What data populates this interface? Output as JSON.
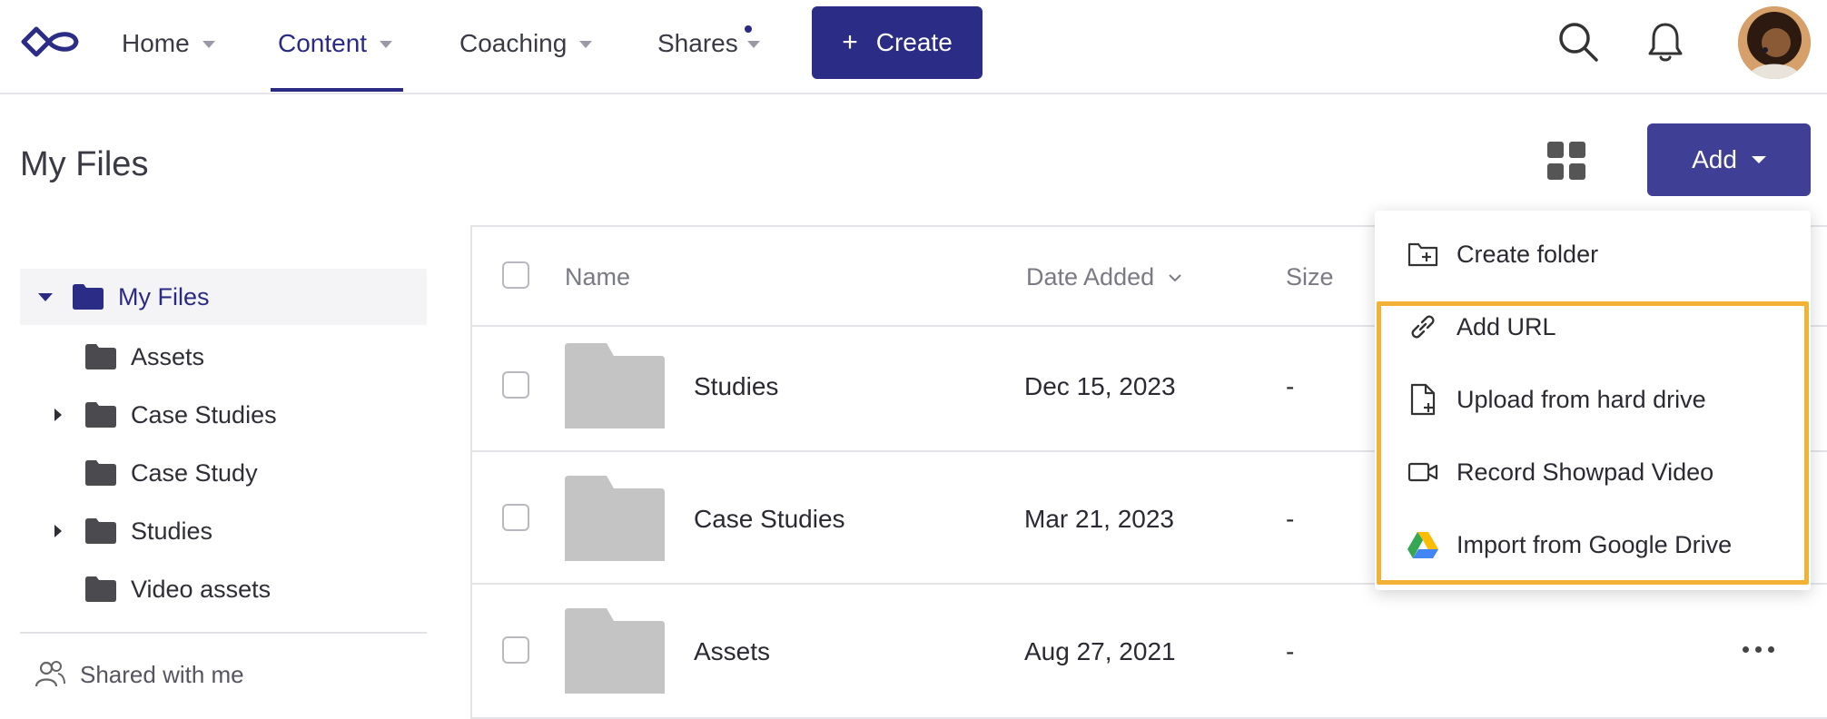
{
  "nav": {
    "items": [
      {
        "label": "Home",
        "active": false
      },
      {
        "label": "Content",
        "active": true
      },
      {
        "label": "Coaching",
        "active": false
      },
      {
        "label": "Shares",
        "active": false
      }
    ],
    "create_label": "Create",
    "icons": [
      "search-icon",
      "bell-icon"
    ]
  },
  "page": {
    "title": "My Files",
    "add_label": "Add"
  },
  "sidebar": {
    "root": "My Files",
    "children": [
      {
        "label": "Assets",
        "expandable": false
      },
      {
        "label": "Case Studies",
        "expandable": true
      },
      {
        "label": "Case Study",
        "expandable": false
      },
      {
        "label": "Studies",
        "expandable": true
      },
      {
        "label": "Video assets",
        "expandable": false
      }
    ],
    "shared_label": "Shared with me"
  },
  "table": {
    "headers": {
      "name": "Name",
      "date": "Date Added",
      "size": "Size"
    },
    "rows": [
      {
        "name": "Studies",
        "date": "Dec 15, 2023",
        "size": "-"
      },
      {
        "name": "Case Studies",
        "date": "Mar 21, 2023",
        "size": "-"
      },
      {
        "name": "Assets",
        "date": "Aug 27, 2021",
        "size": "-"
      }
    ]
  },
  "menu": {
    "items": [
      {
        "label": "Create folder",
        "icon": "folder-plus-icon"
      },
      {
        "label": "Add URL",
        "icon": "link-icon"
      },
      {
        "label": "Upload from hard drive",
        "icon": "file-plus-icon"
      },
      {
        "label": "Record Showpad Video",
        "icon": "video-icon"
      },
      {
        "label": "Import from Google Drive",
        "icon": "google-drive-icon"
      }
    ],
    "highlight_color": "#f4b234"
  },
  "colors": {
    "brand": "#2b2c86",
    "add_button": "#3e3f95"
  }
}
